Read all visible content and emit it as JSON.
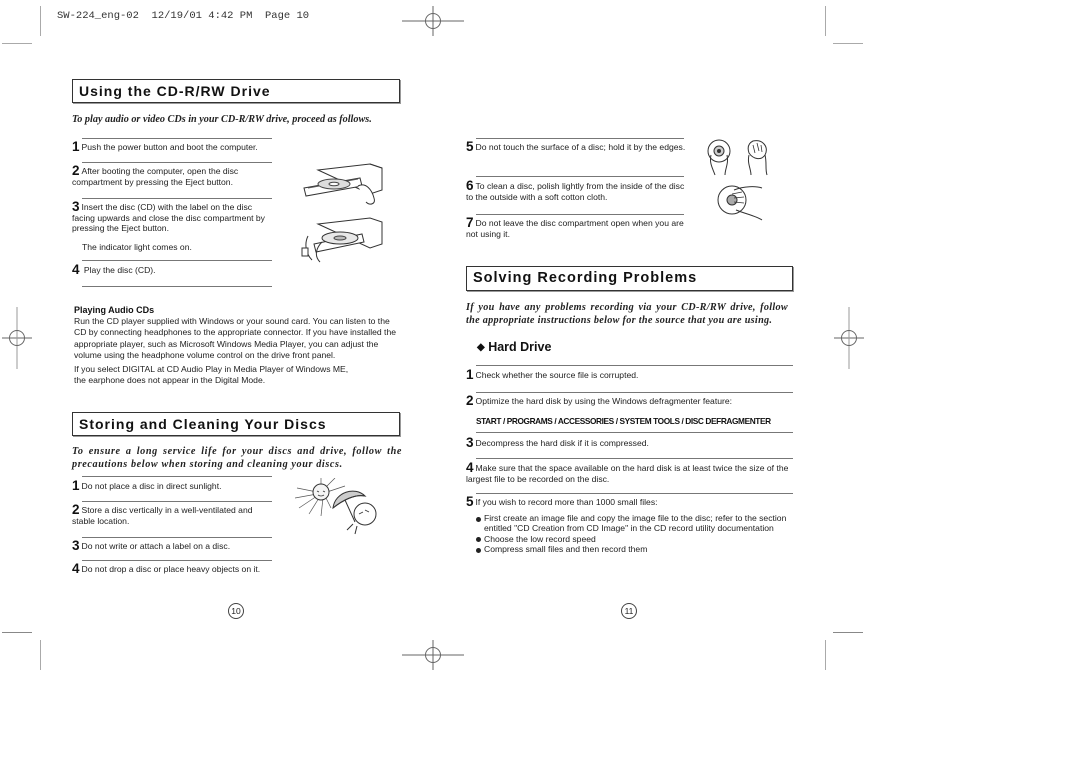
{
  "slug": {
    "file": "SW-224_eng-02",
    "date": "12/19/01",
    "time": "4:42 PM",
    "page_label": "Page 10"
  },
  "left_page": {
    "using_section": {
      "title": "Using the CD-R/RW Drive",
      "intro": "To play audio or video CDs in your CD-R/RW drive, proceed as follows.",
      "steps": [
        {
          "num": "1",
          "text": "Push the power button and boot the computer."
        },
        {
          "num": "2",
          "text": "After booting the computer, open the disc compartment by pressing the Eject button."
        },
        {
          "num": "3",
          "text": "Insert the disc (CD) with the label on the disc facing upwards and close the disc compartment by pressing the Eject button.",
          "note": "The indicator light comes on."
        },
        {
          "num": "4",
          "text": "Play the disc (CD)."
        }
      ],
      "illustrations": [
        "cd-tray-open-illustration",
        "cd-insert-illustration"
      ],
      "audio_cds": {
        "heading": "Playing Audio CDs",
        "paragraph1": "Run the CD player supplied with Windows or your sound card. You can listen to the CD by connecting headphones to the appropriate connector. If you have installed the appropriate player, such as Microsoft Windows Media Player, you can adjust the volume using the headphone volume control on the drive front panel.",
        "paragraph2_line1": "If you select DIGITAL at CD Audio Play in Media Player of Windows ME,",
        "paragraph2_line2": "the earphone does not appear in the Digital Mode."
      }
    },
    "storing_section": {
      "title": "Storing and Cleaning Your Discs",
      "intro": "To ensure a long service life for your discs and drive, follow the precautions below when storing and cleaning your discs.",
      "steps": [
        {
          "num": "1",
          "text": "Do not place a disc in direct sunlight."
        },
        {
          "num": "2",
          "text": "Store a disc vertically in a well-ventilated and stable location."
        },
        {
          "num": "3",
          "text": "Do not write or attach a label on a disc."
        },
        {
          "num": "4",
          "text": "Do not drop a disc or place heavy objects on it."
        }
      ],
      "illustration": "sun-umbrella-disc-illustration"
    },
    "page_number": "10"
  },
  "right_page": {
    "storing_steps_cont": [
      {
        "num": "5",
        "text": "Do not touch the surface of a disc; hold it by the edges."
      },
      {
        "num": "6",
        "text": "To clean a disc, polish lightly from the inside of the disc to the outside with a soft cotton cloth."
      },
      {
        "num": "7",
        "text": "Do not leave the disc compartment open when you are not using it."
      }
    ],
    "illustrations": [
      "holding-disc-illustration",
      "cleaning-disc-illustration"
    ],
    "solving_section": {
      "title": "Solving Recording Problems",
      "intro": "If you have any problems recording via your CD-R/RW drive, follow the appropriate instructions below for the source that you are using.",
      "subsection": {
        "bullet_icon": "diamond-icon",
        "title": "Hard Drive"
      },
      "steps": [
        {
          "num": "1",
          "text": "Check whether the source file is corrupted."
        },
        {
          "num": "2",
          "text": "Optimize the hard disk by using the Windows defragmenter feature:",
          "path": "START / PROGRAMS / ACCESSORIES / SYSTEM TOOLS / DISC DEFRAGMENTER"
        },
        {
          "num": "3",
          "text": "Decompress the hard disk if it is compressed."
        },
        {
          "num": "4",
          "text": "Make sure that the space available on the hard disk is at least twice the size of the largest file to be recorded on the disc."
        },
        {
          "num": "5",
          "text": "If you wish to record more than 1000 small files:",
          "bullets": [
            "First create an image file and copy the image file to the disc; refer to the section entitled \"CD Creation from CD Image\" in the CD record utility documentation",
            "Choose the low record speed",
            "Compress small files and then record them"
          ]
        }
      ]
    },
    "page_number": "11"
  }
}
